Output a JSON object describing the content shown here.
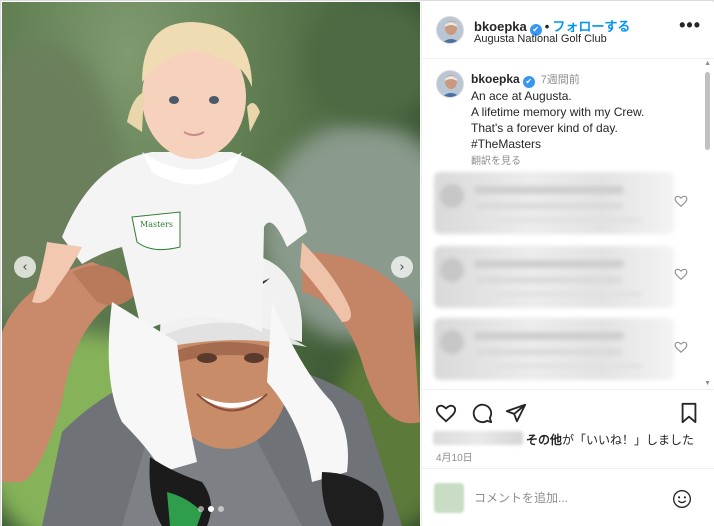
{
  "photo": {
    "prev_arrow": "‹",
    "next_arrow": "›",
    "dot_count": 3,
    "active_dot": 1,
    "cap_text": "Masters"
  },
  "header": {
    "username": "bkoepka",
    "separator": "•",
    "follow_label": "フォローする",
    "location": "Augusta National Golf Club",
    "more_icon": "•••",
    "verified_icon": "✔"
  },
  "caption": {
    "username": "bkoepka",
    "time": "7週間前",
    "lines": [
      "An ace at Augusta.",
      "A lifetime memory with my Crew.",
      "That's a forever kind of day."
    ],
    "hashtag": "#TheMasters",
    "translate_label": "翻訳を見る"
  },
  "likes": {
    "others": "その他",
    "suffix": "が「いいね！」しました"
  },
  "post_date": "4月10日",
  "comment_box": {
    "placeholder": "コメントを追加..."
  },
  "colors": {
    "accent": "#0095f6",
    "verified": "#3897f0",
    "hashtag": "#00376b"
  }
}
